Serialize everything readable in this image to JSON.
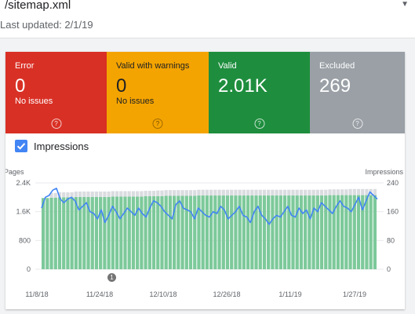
{
  "header": {
    "title": "/sitemap.xml",
    "last_updated": "Last updated: 2/1/19"
  },
  "tiles": [
    {
      "label": "Error",
      "value": "0",
      "sub": "No issues",
      "color": "#d93025"
    },
    {
      "label": "Valid with warnings",
      "value": "0",
      "sub": "No issues",
      "color": "#f4a400",
      "text_color": "#202124"
    },
    {
      "label": "Valid",
      "value": "2.01K",
      "sub": "",
      "color": "#1e8e3e"
    },
    {
      "label": "Excluded",
      "value": "269",
      "sub": "",
      "color": "#9aa0a6"
    }
  ],
  "help_symbol": "?",
  "impressions_toggle": {
    "label": "Impressions",
    "checked": true
  },
  "annotation_marker": {
    "label": "1"
  },
  "chart_data": {
    "type": "bar",
    "left_axis": {
      "label": "Pages",
      "ticks": [
        "0",
        "800",
        "1.6K",
        "2.4K"
      ],
      "max": 2400
    },
    "right_axis": {
      "label": "Impressions",
      "ticks": [
        "0",
        "80",
        "160",
        "240"
      ],
      "max": 240
    },
    "x_tick_labels": [
      "11/8/18",
      "11/24/18",
      "12/10/18",
      "12/26/18",
      "1/11/19",
      "1/27/19"
    ],
    "series": [
      {
        "name": "Valid",
        "kind": "bar",
        "color": "#7dc99a",
        "values": [
          1980,
          1980,
          1990,
          1990,
          2000,
          2000,
          2000,
          2000,
          2010,
          2010,
          2010,
          2010,
          2010,
          2010,
          2010,
          2010,
          2010,
          2020,
          2020,
          2020,
          2020,
          2020,
          2020,
          2020,
          2020,
          2030,
          2030,
          2030,
          2030,
          2030,
          2040,
          2040,
          2040,
          2040,
          2040,
          2040,
          2040,
          2040,
          2050,
          2050,
          2050,
          2050,
          2050,
          2050,
          2050,
          2050,
          2050,
          2050,
          2050,
          2050,
          2050,
          2050,
          2050,
          2050,
          2050,
          2050,
          2050,
          2050,
          2050,
          2050,
          2050,
          2050,
          2050,
          2050,
          2050,
          2050,
          2050,
          2050,
          2050,
          2050,
          2060,
          2060,
          2060,
          2060,
          2060,
          2060,
          2060,
          2060,
          2060,
          2060,
          2060,
          2060
        ]
      },
      {
        "name": "Excluded",
        "kind": "bar",
        "color": "#dadce0",
        "values": [
          0,
          0,
          130,
          130,
          140,
          140,
          140,
          140,
          150,
          150,
          150,
          150,
          150,
          150,
          150,
          150,
          150,
          150,
          150,
          150,
          150,
          150,
          150,
          150,
          150,
          150,
          150,
          150,
          160,
          160,
          160,
          160,
          160,
          160,
          160,
          160,
          160,
          160,
          160,
          160,
          160,
          160,
          160,
          160,
          160,
          160,
          160,
          160,
          160,
          160,
          160,
          160,
          160,
          160,
          160,
          160,
          160,
          160,
          160,
          160,
          160,
          160,
          160,
          160,
          160,
          160,
          160,
          160,
          160,
          160,
          160,
          160,
          160,
          160,
          160,
          170,
          170,
          170,
          170,
          170,
          170,
          170
        ]
      },
      {
        "name": "Impressions",
        "kind": "line",
        "color": "#4285f4",
        "values": [
          170,
          200,
          205,
          220,
          225,
          195,
          185,
          195,
          200,
          190,
          165,
          175,
          185,
          160,
          155,
          140,
          165,
          130,
          150,
          175,
          160,
          140,
          155,
          170,
          160,
          150,
          170,
          155,
          145,
          170,
          190,
          185,
          175,
          160,
          150,
          140,
          180,
          190,
          170,
          165,
          160,
          140,
          170,
          160,
          150,
          145,
          160,
          155,
          175,
          165,
          140,
          150,
          160,
          175,
          150,
          145,
          130,
          160,
          175,
          150,
          140,
          125,
          140,
          150,
          145,
          160,
          175,
          150,
          145,
          170,
          155,
          165,
          140,
          170,
          160,
          185,
          175,
          165,
          155,
          175,
          190,
          175,
          170,
          160,
          180,
          200,
          165,
          190,
          215,
          205,
          195
        ]
      }
    ]
  }
}
